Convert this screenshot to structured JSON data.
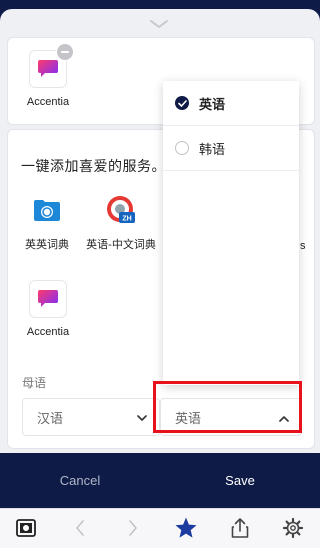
{
  "card_top": {
    "app": {
      "name": "Accentia"
    }
  },
  "services": {
    "heading": "一键添加喜爱的服务。",
    "apps": [
      {
        "name": "英英词典"
      },
      {
        "name": "英语-中文词典"
      },
      {
        "name": "Accentia"
      }
    ],
    "overflow_hint": "s"
  },
  "native_language": {
    "label": "母语",
    "left_select": {
      "value": "汉语"
    },
    "right_select": {
      "value": "英语"
    }
  },
  "dropdown": {
    "options": [
      {
        "label": "英语",
        "selected": true
      },
      {
        "label": "韩语",
        "selected": false
      }
    ]
  },
  "actions": {
    "cancel": "Cancel",
    "save": "Save"
  },
  "toolbar": {
    "items": [
      "capture-icon",
      "back-icon",
      "forward-icon",
      "star-icon",
      "share-icon",
      "settings-icon"
    ]
  },
  "colors": {
    "navy": "#0e1b47",
    "star": "#1b3b9e",
    "highlight": "#e8121c"
  }
}
